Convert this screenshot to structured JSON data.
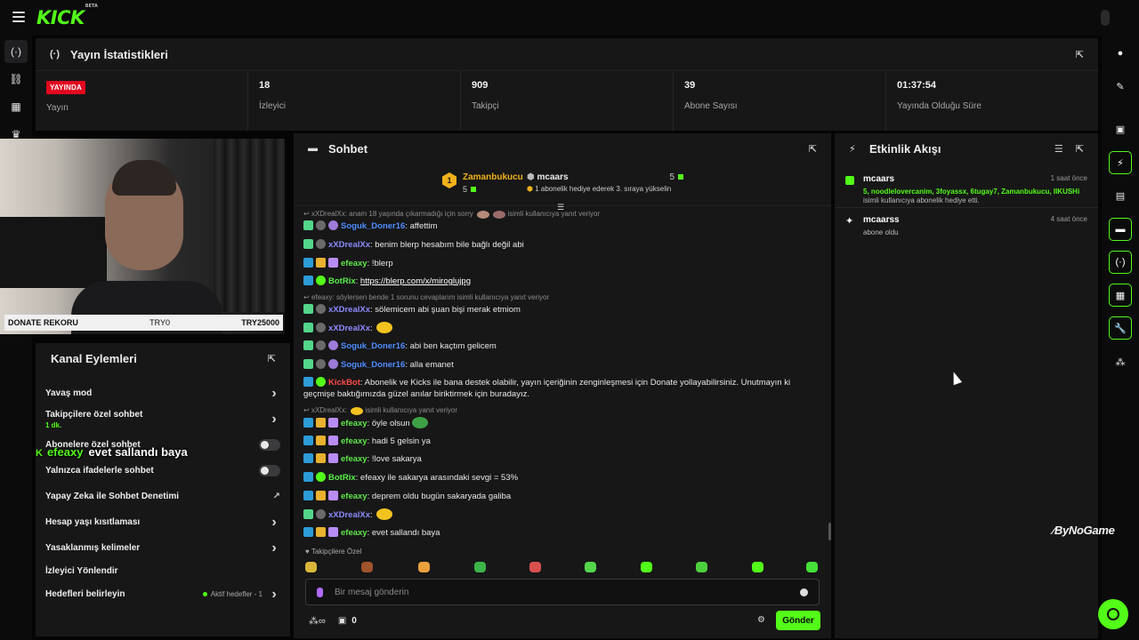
{
  "topbar": {
    "logo": "KICK",
    "beta": "BETA"
  },
  "stats": {
    "title": "Yayın İstatistikleri",
    "live_badge": "YAYINDA",
    "items": [
      {
        "value": "",
        "label": "Yayın"
      },
      {
        "value": "18",
        "label": "İzleyici"
      },
      {
        "value": "909",
        "label": "Takipçi"
      },
      {
        "value": "39",
        "label": "Abone Sayısı"
      },
      {
        "value": "01:37:54",
        "label": "Yayında Olduğu Süre"
      }
    ]
  },
  "donate": {
    "label": "DONATE REKORU",
    "min": "TRY0",
    "max": "TRY25000"
  },
  "overlay": {
    "user": "efeaxy",
    "text": "evet sallandı baya"
  },
  "actions": {
    "title": "Kanal Eylemleri",
    "items": [
      {
        "label": "Yavaş mod",
        "sub": ""
      },
      {
        "label": "Takipçilere özel sohbet",
        "sub": "1 dk."
      },
      {
        "label": "Abonelere özel sohbet",
        "sub": ""
      },
      {
        "label": "Yalnızca ifadelerle sohbet",
        "sub": ""
      },
      {
        "label": "Yapay Zeka ile Sohbet Denetimi",
        "sub": ""
      },
      {
        "label": "Hesap yaşı kısıtlaması",
        "sub": ""
      },
      {
        "label": "Yasaklanmış kelimeler",
        "sub": ""
      },
      {
        "label": "İzleyici Yönlendir",
        "sub": ""
      },
      {
        "label": "Hedefleri belirleyin",
        "sub": ""
      }
    ],
    "goals_status": "Aktif hedefler - 1"
  },
  "chat": {
    "title": "Sohbet",
    "pinned": [
      {
        "name": "Zamanbukucu",
        "count": "5",
        "rank": "1"
      },
      {
        "name": "mcaars",
        "count": "5",
        "note": "1 abonelik hediye ederek 3. sıraya yükselin"
      }
    ],
    "messages": [
      {
        "reply": "xXDrealXx: anam 18 yaşında çıkarmadığı için sorry",
        "reply_tail": "isimli kullanıcıya yanıt veriyor"
      },
      {
        "user": "Soguk_Doner16",
        "text": "affettim"
      },
      {
        "user": "xXDrealXx",
        "text": "benim blerp hesabım bile bağlı değil abi"
      },
      {
        "user": "efeaxy",
        "text": "!blerp"
      },
      {
        "user": "BotRix",
        "text": "https://blerp.com/x/miroglujpg"
      },
      {
        "reply": "efeaxy: söylersen bende 1 sorunu cevaplarım isimli kullanıcıya yanıt veriyor"
      },
      {
        "user": "xXDrealXx",
        "text": "sölemicem abi şuan bişi merak etmiom"
      },
      {
        "user": "xXDrealXx",
        "text": ""
      },
      {
        "user": "Soguk_Doner16",
        "text": "abi ben kaçtım gelicem"
      },
      {
        "user": "Soguk_Doner16",
        "text": "alla emanet"
      },
      {
        "user": "KickBot",
        "text": "Abonelik ve Kicks ile bana destek olabilir, yayın içeriğinin zenginleşmesi için Donate yollayabilirsiniz. Unutmayın ki geçmişe baktığımızda güzel anılar biriktirmek için buradayız."
      },
      {
        "reply": "xXDrealXx:",
        "reply_tail": "isimli kullanıcıya yanıt veriyor"
      },
      {
        "user": "efeaxy",
        "text": "öyle olsun"
      },
      {
        "user": "efeaxy",
        "text": "hadi 5 gelsin ya"
      },
      {
        "user": "efeaxy",
        "text": "!love sakarya"
      },
      {
        "user": "BotRix",
        "text": "efeaxy ile sakarya arasındaki sevgi = 53%"
      },
      {
        "user": "efeaxy",
        "text": "deprem oldu bugün sakaryada galiba"
      },
      {
        "user": "xXDrealXx",
        "text": ""
      },
      {
        "user": "efeaxy",
        "text": "evet sallandı baya"
      }
    ],
    "emote_label": "Takipçilere Özel",
    "input_placeholder": "Bir mesaj gönderin",
    "kicks_count": "0",
    "send_label": "Gönder"
  },
  "activity": {
    "title": "Etkinlik Akışı",
    "events": [
      {
        "user": "mcaars",
        "time": "1 saat önce",
        "names": "5, noodlelovercanim, 3foyassx, 6tugay7, Zamanbukucu, IIKUSHi",
        "desc": "isimli kullanıcıya abonelik hediye etti."
      },
      {
        "user": "mcaarss",
        "time": "4 saat önce",
        "names": "",
        "desc": "abone oldu"
      }
    ]
  },
  "watermark": "ByNoGame",
  "colors": {
    "accent": "#53fc18",
    "live": "#e1081f",
    "panel": "#171718",
    "background": "#050505"
  }
}
